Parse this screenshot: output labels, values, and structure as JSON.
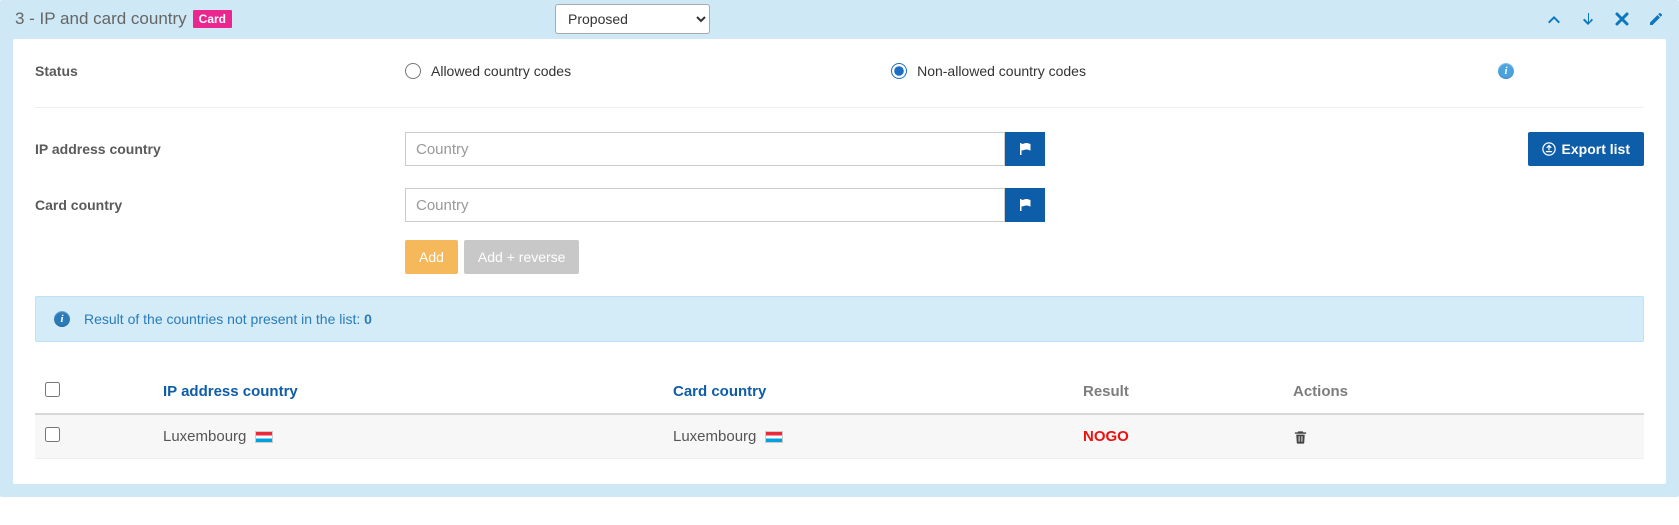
{
  "header": {
    "prefix": "3 - IP and card country",
    "badge": "Card",
    "state_selected": "Proposed"
  },
  "form": {
    "status_label": "Status",
    "radio_allowed": "Allowed country codes",
    "radio_nonallowed": "Non-allowed country codes",
    "ip_label": "IP address country",
    "card_label": "Card country",
    "country_placeholder": "Country",
    "add_btn": "Add",
    "add_rev_btn": "Add + reverse",
    "export_btn": "Export list"
  },
  "alert": {
    "text": "Result of the countries not present in the list: ",
    "value": "0"
  },
  "table": {
    "headers": {
      "ip": "IP address country",
      "card": "Card country",
      "result": "Result",
      "actions": "Actions"
    },
    "rows": [
      {
        "ip": "Luxembourg",
        "card": "Luxembourg",
        "result": "NOGO"
      }
    ]
  }
}
